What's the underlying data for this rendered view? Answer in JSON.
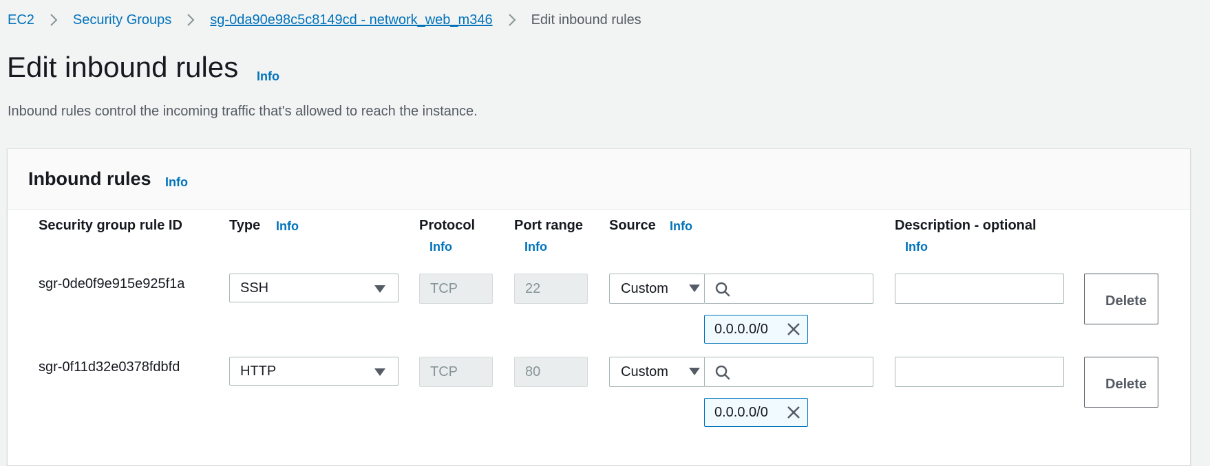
{
  "breadcrumb": {
    "items": [
      {
        "label": "EC2"
      },
      {
        "label": "Security Groups"
      },
      {
        "label": "sg-0da90e98c5c8149cd - network_web_m346"
      },
      {
        "label": "Edit inbound rules"
      }
    ]
  },
  "page": {
    "title": "Edit inbound rules",
    "title_info": "Info",
    "description": "Inbound rules control the incoming traffic that's allowed to reach the instance."
  },
  "panel": {
    "title": "Inbound rules",
    "info": "Info",
    "columns": {
      "rule_id": "Security group rule ID",
      "type": "Type",
      "type_info": "Info",
      "protocol": "Protocol",
      "protocol_info": "Info",
      "port_range": "Port range",
      "port_range_info": "Info",
      "source": "Source",
      "source_info": "Info",
      "description": "Description - optional",
      "description_info": "Info"
    },
    "rows": [
      {
        "rule_id": "sgr-0de0f9e915e925f1a",
        "type": "SSH",
        "protocol": "TCP",
        "port_range": "22",
        "source_type": "Custom",
        "source_search": "",
        "cidr": "0.0.0.0/0",
        "description": "",
        "delete_label": "Delete"
      },
      {
        "rule_id": "sgr-0f11d32e0378fdbfd",
        "type": "HTTP",
        "protocol": "TCP",
        "port_range": "80",
        "source_type": "Custom",
        "source_search": "",
        "cidr": "0.0.0.0/0",
        "description": "",
        "delete_label": "Delete"
      }
    ]
  },
  "colors": {
    "link": "#0073bb",
    "background": "#f2f3f3",
    "text": "#16191f",
    "secondary_text": "#545b64",
    "token_border": "#0073bb",
    "token_bg": "#f1faff"
  }
}
